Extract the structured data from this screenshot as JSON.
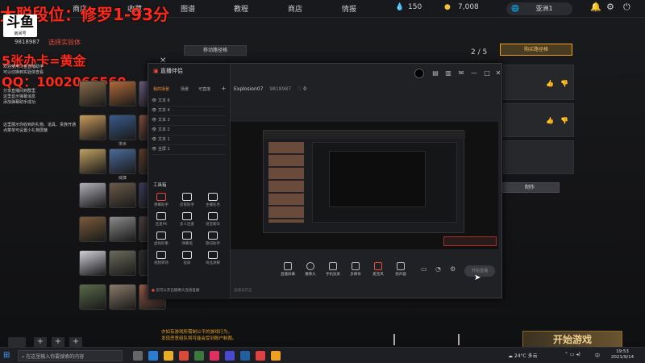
{
  "topnav": {
    "items": [
      "商店",
      "收藏",
      "图谱",
      "教程",
      "商店",
      "情报"
    ],
    "gems": "150",
    "coins": "7,008",
    "region": "亚洲1",
    "gem_icon": "water-drop-icon",
    "coin_icon": "coin-icon"
  },
  "overlay": {
    "rank_text": "大聪段位：修罗1-93分",
    "logo_text": "斗鱼",
    "logo_sub": "房间号",
    "room_id": "9818987",
    "room_label": "选择实验体",
    "promo": "5张办卡=黄金",
    "phone": "QQ：1002066560",
    "notice_lines": [
      "欢迎使用斗鱼直播助手",
      "可以切换到实验体查看",
      "分享直播间到群里",
      "这里显示弹幕消息",
      "添加弹幕助手成功"
    ],
    "notice2_lines": [
      "这里展示你收到的礼物、道具、贵族开通",
      "点菜单可设置小礼物屏蔽"
    ]
  },
  "game": {
    "move_path_label": "移动路径格",
    "page_counter": "2 / 5",
    "buy_path_label": "购买路径格",
    "make_label": "制作",
    "start_game": "开始游戏",
    "bottom_notice": [
      "亦如有游戏所需制公平的游戏行为。",
      "发现恶意组队将可能会受到账户制裁。"
    ]
  },
  "heroes": [
    {
      "name": "",
      "color": "#8a6b4a"
    },
    {
      "name": "",
      "color": "#b06a3a"
    },
    {
      "name": "",
      "color": "#6a5a7a"
    },
    {
      "name": "",
      "color": "#c89a5a"
    },
    {
      "name": "埃米",
      "color": "#3a5a8a"
    },
    {
      "name": "",
      "color": "#7a4a3a"
    },
    {
      "name": "",
      "color": "#c0a060"
    },
    {
      "name": "威廉",
      "color": "#4a6a9a"
    },
    {
      "name": "",
      "color": "#5a3a2a"
    },
    {
      "name": "",
      "color": "#b0b0b8"
    },
    {
      "name": "",
      "color": "#6a5a4a"
    },
    {
      "name": "",
      "color": "#3a3a5a"
    },
    {
      "name": "",
      "color": "#7a5a3a"
    },
    {
      "name": "",
      "color": "#8a8a8a"
    },
    {
      "name": "",
      "color": "#4a3a3a"
    },
    {
      "name": "",
      "color": "#d0d0d8"
    },
    {
      "name": "",
      "color": "#6a6a5a"
    },
    {
      "name": "",
      "color": "#2a2a2a"
    },
    {
      "name": "",
      "color": "#5a6a4a"
    },
    {
      "name": "",
      "color": "#8a7a6a"
    },
    {
      "name": "",
      "color": "#9a5a4a"
    }
  ],
  "obs": {
    "title": "直播伴侣",
    "tabs": [
      "我的场景",
      "场景",
      "可直接"
    ],
    "layers": [
      "文本 6",
      "文本 4",
      "文本 3",
      "文本 2",
      "文本 1",
      "全屏 1"
    ],
    "tools_label": "工具箱",
    "tools": [
      "弹幕助手",
      "房管助手",
      "主播任务",
      "连麦PK",
      "多人连麦",
      "语音聊天",
      "虚拟形象",
      "弹幕墙",
      "歌词助手",
      "视频转场",
      "投屏",
      "商品讲解"
    ],
    "bottom_tip": "您可以开启摄像头连接直播",
    "preview_user": "Explosion07",
    "preview_room": "9818987",
    "preview_count": "0",
    "controls": [
      "直播屏幕",
      "摄像头",
      "手机投屏",
      "多媒体",
      "麦克风",
      "扬声器"
    ],
    "start_btn": "开始直播",
    "status": "直播未开启"
  },
  "taskbar": {
    "search": "在这里输入你要搜索的内容",
    "weather": "24°C 多云",
    "lang": "中",
    "time": "19:53",
    "date": "2021/9/14"
  }
}
